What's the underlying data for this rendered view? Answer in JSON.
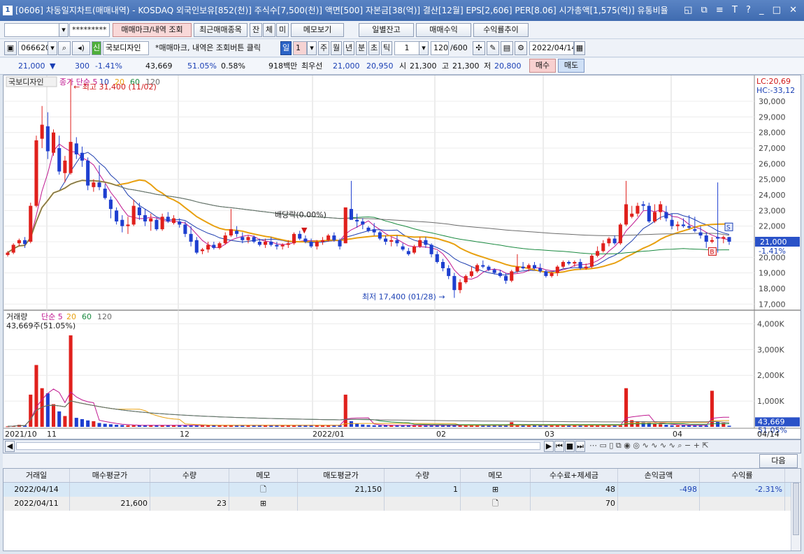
{
  "window": {
    "screen_no": "1",
    "title": "[0606] 차동일지차트(매매내역) - KOSDAQ 외국인보유[852(천)] 주식수[7,500(천)] 액면[500] 자본금[38(억)] 결산[12월] EPS[2,606] PER[8.06] 시가총액[1,575(억)] 유통비율",
    "controls": "◱ ⧉ ≡ T ? _ □ ✕"
  },
  "toolbar1": {
    "account": "",
    "password": "*********",
    "btn_markview": "매매마크/내역 조회",
    "btn_recent": "최근매매종목",
    "btn_jan": "잔",
    "btn_che": "체",
    "btn_mi": "미",
    "btn_memo": "메모보기",
    "btn_daily": "일별잔고",
    "btn_profit": "매매수익",
    "btn_trend": "수익률추이"
  },
  "toolbar2": {
    "code": "066620",
    "stock_badge": "신",
    "stock_name": "국보디자인",
    "hint": "*매매마크, 내역은 조회버튼 클릭",
    "period_day": "일",
    "period_n": "1",
    "period_week": "주",
    "period_month": "월",
    "period_year": "년",
    "period_min": "분",
    "period_sec": "초",
    "period_tick": "틱",
    "tick_n": "1",
    "count": "120",
    "count_max": "/600",
    "date": "2022/04/14"
  },
  "quote": {
    "price": "21,000",
    "change": "300",
    "change_pct": "-1.41%",
    "volume": "43,669",
    "vol_ratio": "51.05%",
    "turnover": "0.58%",
    "amount": "918백만",
    "best_label": "최우선",
    "best_bid": "21,000",
    "best_ask": "20,950",
    "open_label": "시",
    "open": "21,300",
    "high_label": "고",
    "high": "21,300",
    "low_label": "저",
    "low": "20,800",
    "buy": "매수",
    "sell": "매도"
  },
  "chart_data": [
    {
      "type": "candlestick",
      "panel_name": "국보디자인",
      "legend": [
        "종가 단순 5",
        "10",
        "20",
        "60",
        "120"
      ],
      "legend_colors": [
        "#c01890",
        "#1f3fb0",
        "#e8a010",
        "#1a8a40",
        "#6c6c6c"
      ],
      "right_top_labels": [
        "LC:20,69",
        "HC:-33,12"
      ],
      "ylim": [
        16700,
        31300
      ],
      "yticks": [
        "30,000",
        "29,000",
        "28,000",
        "27,000",
        "26,000",
        "25,000",
        "24,000",
        "23,000",
        "22,000",
        "21,000",
        "20,000",
        "19,000",
        "18,000",
        "17,000"
      ],
      "current_price_tag": "21,000",
      "current_change_tag": "-1.41%",
      "annotations": {
        "high": "최고 31,400 (11/02)",
        "low": "최저 17,400 (01/28)",
        "dividend": "배당락(0.00%)"
      },
      "x_labels": [
        "2021/10",
        "11",
        "12",
        "2022/01",
        "02",
        "03",
        "04",
        "04/14"
      ],
      "candles_ohlc": [
        [
          20150,
          20400,
          20050,
          20300
        ],
        [
          20300,
          20900,
          20200,
          20800
        ],
        [
          20900,
          21200,
          20700,
          21100
        ],
        [
          21100,
          21300,
          20600,
          20850
        ],
        [
          21000,
          23500,
          20900,
          23300
        ],
        [
          23300,
          27800,
          23200,
          27500
        ],
        [
          27600,
          29700,
          27000,
          28500
        ],
        [
          28400,
          29300,
          26300,
          26800
        ],
        [
          26700,
          28200,
          26500,
          28000
        ],
        [
          27000,
          27800,
          25300,
          25500
        ],
        [
          25400,
          26500,
          24800,
          26200
        ],
        [
          25400,
          31400,
          25300,
          27400
        ],
        [
          27300,
          27700,
          26300,
          26600
        ],
        [
          26700,
          27100,
          25800,
          26200
        ],
        [
          26200,
          26400,
          24300,
          24600
        ],
        [
          24500,
          25000,
          24200,
          24800
        ],
        [
          24800,
          25900,
          24300,
          24500
        ],
        [
          24400,
          24700,
          23700,
          23800
        ],
        [
          23700,
          23900,
          22500,
          23100
        ],
        [
          23000,
          23200,
          22100,
          22300
        ],
        [
          22400,
          22700,
          21600,
          22000
        ],
        [
          22000,
          22600,
          21500,
          22100
        ],
        [
          22100,
          23700,
          22000,
          23300
        ],
        [
          23200,
          23500,
          22400,
          22700
        ],
        [
          22700,
          23100,
          22000,
          22300
        ],
        [
          22300,
          22800,
          21700,
          22500
        ],
        [
          22400,
          22500,
          21700,
          21800
        ],
        [
          21800,
          22800,
          21700,
          22600
        ],
        [
          22600,
          22900,
          22200,
          22300
        ],
        [
          22200,
          22700,
          22100,
          22500
        ],
        [
          22300,
          22500,
          21900,
          22100
        ],
        [
          22100,
          22300,
          21300,
          21500
        ],
        [
          21500,
          22000,
          20700,
          21000
        ],
        [
          21100,
          21300,
          20200,
          20300
        ],
        [
          20400,
          20600,
          20200,
          20500
        ],
        [
          20500,
          21000,
          20300,
          20800
        ],
        [
          20800,
          21000,
          20500,
          20600
        ],
        [
          20600,
          21000,
          20500,
          20900
        ],
        [
          20900,
          21600,
          20800,
          21400
        ],
        [
          21400,
          23100,
          21300,
          21800
        ],
        [
          21700,
          22000,
          21300,
          21500
        ],
        [
          21300,
          21600,
          20900,
          21100
        ],
        [
          21100,
          21400,
          20900,
          21300
        ],
        [
          21300,
          21400,
          20900,
          21000
        ],
        [
          21000,
          21200,
          20700,
          20800
        ],
        [
          20800,
          21200,
          20600,
          21000
        ],
        [
          21000,
          21300,
          20700,
          20800
        ],
        [
          20800,
          21000,
          20500,
          20700
        ],
        [
          20700,
          20900,
          20500,
          20800
        ],
        [
          20800,
          21100,
          20600,
          20900
        ],
        [
          20900,
          21600,
          20800,
          21500
        ],
        [
          21500,
          21700,
          21100,
          21200
        ],
        [
          21200,
          21400,
          20900,
          21000
        ],
        [
          21000,
          21200,
          20600,
          20700
        ],
        [
          20700,
          21100,
          20500,
          21000
        ],
        [
          21000,
          21300,
          20800,
          21100
        ],
        [
          21100,
          21500,
          21000,
          21400
        ],
        [
          21400,
          21600,
          21000,
          21100
        ],
        [
          21100,
          21200,
          20500,
          20700
        ],
        [
          20900,
          22900,
          20900,
          23200
        ],
        [
          23100,
          24900,
          22700,
          22400
        ],
        [
          22400,
          22800,
          21900,
          22300
        ],
        [
          22300,
          22500,
          21800,
          22100
        ],
        [
          21900,
          22000,
          21600,
          21700
        ],
        [
          21800,
          22200,
          21400,
          21600
        ],
        [
          21600,
          21700,
          21100,
          21200
        ],
        [
          21200,
          21400,
          20800,
          21000
        ],
        [
          21000,
          21300,
          20700,
          21100
        ],
        [
          21100,
          21400,
          20700,
          20900
        ],
        [
          20700,
          20900,
          20400,
          20500
        ],
        [
          20400,
          20600,
          20100,
          20200
        ],
        [
          20300,
          20800,
          20200,
          20700
        ],
        [
          20700,
          21300,
          20600,
          21100
        ],
        [
          21100,
          21300,
          20600,
          20800
        ],
        [
          20800,
          20900,
          20000,
          20200
        ],
        [
          20200,
          20400,
          19600,
          19700
        ],
        [
          19700,
          19900,
          19100,
          19300
        ],
        [
          19300,
          19500,
          18600,
          18800
        ],
        [
          18800,
          19000,
          17400,
          17900
        ],
        [
          17900,
          18600,
          17700,
          18400
        ],
        [
          18400,
          18900,
          18300,
          18800
        ],
        [
          18800,
          19400,
          18700,
          19100
        ],
        [
          19100,
          19600,
          19000,
          19500
        ],
        [
          19500,
          19800,
          19300,
          19400
        ],
        [
          19400,
          19500,
          19100,
          19200
        ],
        [
          19200,
          19300,
          18900,
          19000
        ],
        [
          19000,
          19200,
          18700,
          18800
        ],
        [
          18800,
          19000,
          18300,
          18500
        ],
        [
          18500,
          19200,
          18400,
          19100
        ],
        [
          19100,
          20200,
          19000,
          19400
        ],
        [
          19400,
          19700,
          19200,
          19300
        ],
        [
          19300,
          19600,
          19100,
          19500
        ],
        [
          19500,
          19700,
          19200,
          19300
        ],
        [
          19300,
          19600,
          19000,
          19100
        ],
        [
          19100,
          19200,
          18700,
          18800
        ],
        [
          18800,
          19100,
          18700,
          19000
        ],
        [
          19000,
          19500,
          18800,
          19400
        ],
        [
          19400,
          19800,
          19300,
          19700
        ],
        [
          19700,
          19800,
          19500,
          19600
        ],
        [
          19600,
          19800,
          19400,
          19700
        ],
        [
          19700,
          19900,
          19200,
          19300
        ],
        [
          19300,
          19600,
          19200,
          19400
        ],
        [
          19400,
          20200,
          19300,
          20100
        ],
        [
          20100,
          20700,
          20000,
          20400
        ],
        [
          20400,
          21100,
          20300,
          20900
        ],
        [
          20900,
          21300,
          20700,
          21200
        ],
        [
          21200,
          21400,
          20800,
          20900
        ],
        [
          20900,
          22200,
          20800,
          22100
        ],
        [
          22100,
          24900,
          22000,
          23400
        ],
        [
          22600,
          23300,
          22500,
          22800
        ],
        [
          22800,
          23500,
          22600,
          23300
        ],
        [
          23400,
          23600,
          23000,
          23300
        ],
        [
          23300,
          23500,
          22200,
          22300
        ],
        [
          22300,
          23400,
          22200,
          22900
        ],
        [
          22900,
          23600,
          22400,
          23400
        ],
        [
          22900,
          23300,
          22300,
          22500
        ],
        [
          22400,
          22800,
          21800,
          22000
        ],
        [
          22000,
          22300,
          21700,
          22100
        ],
        [
          22100,
          22500,
          21900,
          22000
        ],
        [
          22000,
          22700,
          21800,
          21900
        ],
        [
          21800,
          22600,
          21600,
          21700
        ],
        [
          21600,
          22000,
          21200,
          21400
        ],
        [
          21400,
          21600,
          20600,
          21000
        ],
        [
          21000,
          21300,
          20900,
          21100
        ],
        [
          21300,
          24800,
          20300,
          21200
        ],
        [
          21200,
          21400,
          20900,
          21300
        ],
        [
          21300,
          21300,
          20800,
          21000
        ]
      ]
    },
    {
      "type": "bar",
      "panel_name": "거래량",
      "legend": [
        "단순 5",
        "20",
        "60",
        "120"
      ],
      "legend_colors": [
        "#c01890",
        "#e8a010",
        "#1a8a40",
        "#6c6c6c"
      ],
      "summary": "43,669주(51.05%)",
      "ylim": [
        0,
        4500
      ],
      "yticks": [
        "4,000K",
        "3,000K",
        "2,000K",
        "1,000K"
      ],
      "current_tag": "43,669",
      "current_pct_tag": "51.05%",
      "volumes_k": [
        20,
        40,
        80,
        60,
        1250,
        2400,
        1500,
        1300,
        880,
        600,
        420,
        3550,
        350,
        300,
        250,
        220,
        150,
        120,
        100,
        80,
        70,
        60,
        60,
        60,
        60,
        60,
        60,
        60,
        60,
        60,
        60,
        60,
        60,
        60,
        60,
        60,
        60,
        60,
        60,
        60,
        60,
        60,
        60,
        60,
        60,
        60,
        60,
        60,
        60,
        60,
        60,
        60,
        60,
        60,
        60,
        60,
        60,
        60,
        60,
        1250,
        220,
        120,
        90,
        70,
        60,
        60,
        60,
        60,
        60,
        60,
        60,
        60,
        60,
        60,
        60,
        60,
        60,
        60,
        60,
        60,
        60,
        60,
        60,
        60,
        60,
        60,
        60,
        60,
        180,
        60,
        60,
        60,
        60,
        60,
        60,
        60,
        60,
        60,
        60,
        60,
        60,
        60,
        60,
        60,
        60,
        60,
        60,
        60,
        1500,
        260,
        200,
        180,
        150,
        120,
        100,
        80,
        60,
        60,
        60,
        60,
        60,
        60,
        60,
        1400,
        200,
        150,
        44
      ]
    }
  ],
  "bottom_nav": {
    "labels": [
      "▶",
      "⏮",
      "■",
      "⏭"
    ]
  },
  "trade_table": {
    "next_button": "다음",
    "headers": [
      "거래일",
      "매수평균가",
      "수량",
      "메모",
      "매도평균가",
      "수량",
      "메모",
      "수수료+제세금",
      "손익금액",
      "수익률"
    ],
    "rows": [
      {
        "date": "2022/04/14",
        "buy_avg": "",
        "buy_qty": "",
        "buy_memo": "",
        "sell_avg": "21,150",
        "sell_qty": "1",
        "sell_memo": "",
        "fee": "48",
        "pnl": "-498",
        "rate": "-2.31%"
      },
      {
        "date": "2022/04/11",
        "buy_avg": "21,600",
        "buy_qty": "23",
        "buy_memo": "",
        "sell_avg": "",
        "sell_qty": "",
        "sell_memo": "",
        "fee": "70",
        "pnl": "",
        "rate": ""
      }
    ]
  }
}
